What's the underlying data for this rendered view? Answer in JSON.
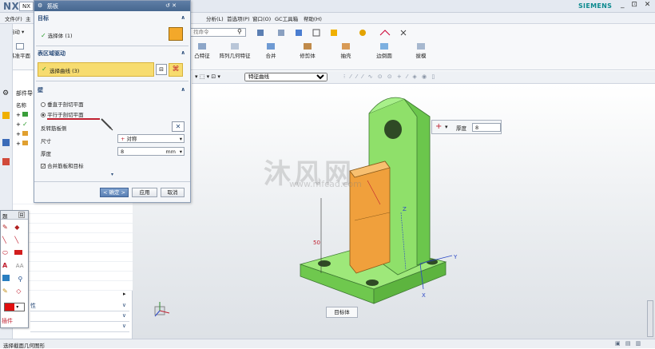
{
  "app": {
    "logo": "NX",
    "tab": "NX",
    "brand": "SIEMENS",
    "window_controls": "_ ⊡ ✕"
  },
  "menubar": {
    "items_left": [
      "文件(F)",
      "主"
    ],
    "items_right": [
      "分析(L)",
      "首选项(P)",
      "窗口(O)",
      "GC工具箱",
      "帮助(H)"
    ]
  },
  "toolbar_left": {
    "start_label": "启动",
    "datum_plane": "基准平面"
  },
  "ribbon": {
    "search_placeholder": "找命令",
    "buttons": [
      "凸特征",
      "阵列几何特征",
      "合并",
      "修剪体",
      "抽壳",
      "边倒圆",
      "拔模"
    ]
  },
  "toolbar2": {
    "filter_value": "特征曲线"
  },
  "dialog": {
    "title": "筋板",
    "title_icons": "↺ ✕",
    "target": {
      "header": "目标",
      "select_body": "选择体 (1)"
    },
    "section": {
      "header": "表区域驱动",
      "select_curve": "选择曲线 (3)"
    },
    "wall": {
      "header": "壁",
      "radio1": "垂直于剖切平面",
      "radio2": "平行于剖切平面",
      "radio2_selected": true,
      "reverse_label": "反转筋板侧",
      "size_label": "尺寸",
      "size_value": "对称",
      "thickness_label": "厚度",
      "thickness_value": "8",
      "thickness_unit": "mm",
      "merge_label": "合并筋板和目标",
      "merge_checked": true
    },
    "buttons": {
      "ok": "< 确定 >",
      "apply": "应用",
      "cancel": "取消"
    }
  },
  "navpanel": {
    "title": "部件导",
    "name_col": "名称"
  },
  "palette": {
    "header": "题",
    "bottom_label": "插件"
  },
  "bottom_panels": [
    "性",
    "",
    ""
  ],
  "hud": {
    "thickness_label": "厚度",
    "thickness_value": "8"
  },
  "tag": {
    "label": "目标体"
  },
  "status": {
    "text": "选择截面几何图形"
  },
  "watermark": {
    "main": "沐风网",
    "sub": "www.mfcad.com"
  },
  "colors": {
    "part_green": "#8fe06a",
    "rib_orange": "#f0a03c",
    "highlight_yellow": "#f7dc6f",
    "titlebar_blue": "#4e6f98"
  }
}
